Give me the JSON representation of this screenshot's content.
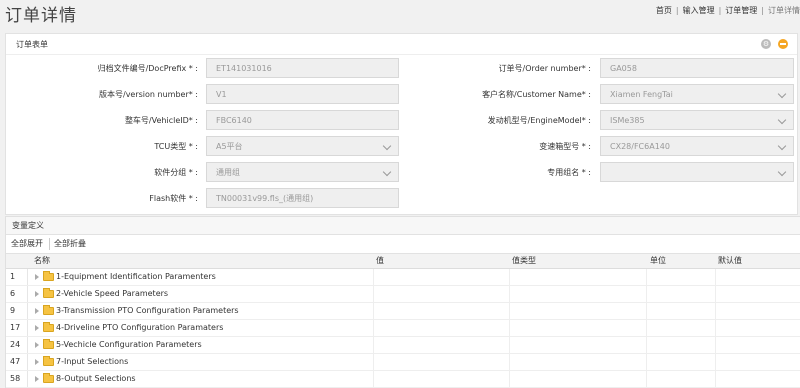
{
  "header": {
    "title": "订单详情",
    "breadcrumb": [
      "首页",
      "输入管理",
      "订单管理",
      "订单详情"
    ]
  },
  "form_panel": {
    "title": "订单表单",
    "icons": {
      "gear": "gear-icon",
      "collapse": "minus-circle-icon"
    },
    "fields": [
      {
        "label": "归档文件编号/DocPrefix * :",
        "value": "ET141031016",
        "select": false
      },
      {
        "label": "订单号/Order number* :",
        "value": "GA058",
        "select": false
      },
      {
        "label": "版本号/version number* :",
        "value": "V1",
        "select": false
      },
      {
        "label": "客户名称/Customer Name* :",
        "value": "Xiamen FengTai",
        "select": true
      },
      {
        "label": "整车号/VehicleID* :",
        "value": "FBC6140",
        "select": false
      },
      {
        "label": "发动机型号/EngineModel* :",
        "value": "ISMe385",
        "select": true
      },
      {
        "label": "TCU类型 * :",
        "value": "A5平台",
        "select": true
      },
      {
        "label": "变速箱型号 * :",
        "value": "CX28/FC6A140",
        "select": true
      },
      {
        "label": "软件分组 * :",
        "value": "通用组",
        "select": true
      },
      {
        "label": "专用组名 * :",
        "value": "",
        "select": true
      },
      {
        "label": "Flash软件 * :",
        "value": "TN00031v99.fls_(通用组)",
        "select": false
      }
    ]
  },
  "variable_grid": {
    "title": "变量定义",
    "toolbar": {
      "expand_all": "全部展开",
      "collapse_all": "全部折叠"
    },
    "columns": [
      "名称",
      "值",
      "值类型",
      "单位",
      "默认值"
    ],
    "rows": [
      {
        "num": "1",
        "name": "1-Equipment Identification Paramenters"
      },
      {
        "num": "6",
        "name": "2-Vehicle Speed Parameters"
      },
      {
        "num": "9",
        "name": "3-Transmission PTO Configuration Parameters"
      },
      {
        "num": "17",
        "name": "4-Driveline PTO Configuration Paramaters"
      },
      {
        "num": "24",
        "name": "5-Vechicle Configuration Parameters"
      },
      {
        "num": "47",
        "name": "7-Input Selections"
      },
      {
        "num": "58",
        "name": "8-Output Selections"
      }
    ]
  }
}
